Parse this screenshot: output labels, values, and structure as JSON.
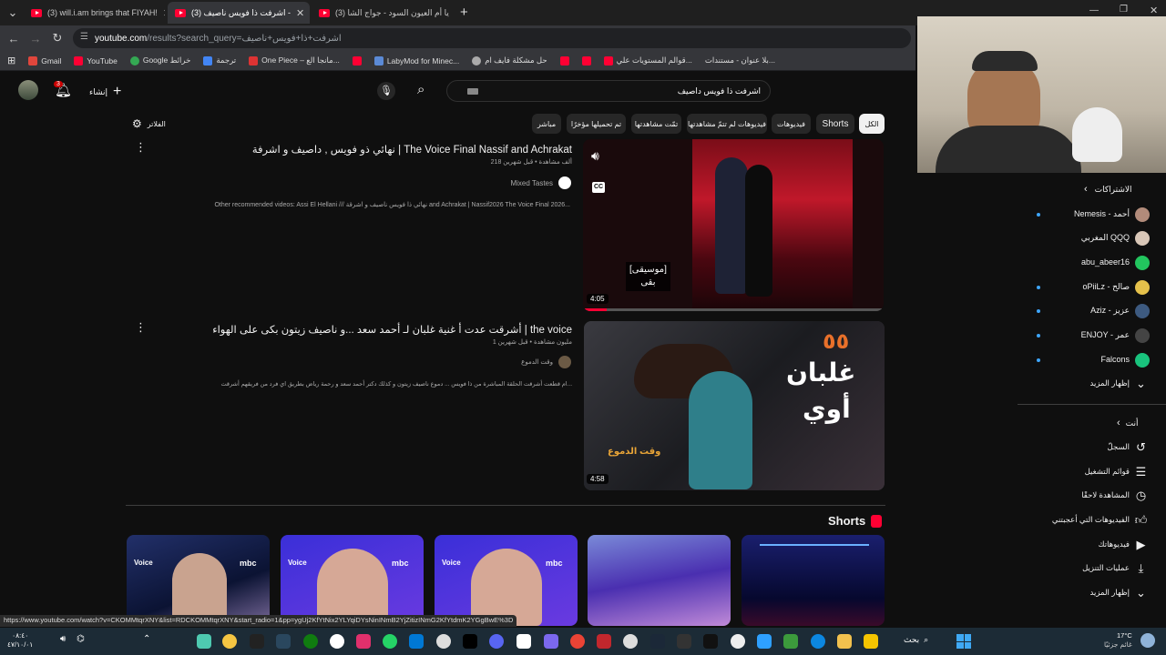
{
  "tabs": [
    {
      "title": "(3) will.i.am brings that FIYAH!",
      "active": false
    },
    {
      "title": "(3) اشرفت ذا فويس ناصيف -",
      "active": true
    },
    {
      "title": "(3) يا أم العيون السود - جواج الشا",
      "active": false
    }
  ],
  "address": {
    "domain": "youtube.com",
    "path": "/results?search_query=اشرفت+ذا+فويس+ناصيف"
  },
  "bookmarks": [
    "Gmail",
    "YouTube",
    "Google خرائط",
    "ترجمة",
    "One Piece – مانجا الع...",
    "LabyMod for Minec...",
    "حل مشكلة فايف ام",
    "قوالم المستويات علي...",
    "بلا عنوان - مستندات..."
  ],
  "header": {
    "create_label": "إنشاء",
    "notif_count": "3",
    "search_value": "اشرفت ذا فويس داصيف"
  },
  "chips": [
    "الكل",
    "Shorts",
    "فيديوهات",
    "فيديوهات لم تتمّ مشاهدتها",
    "تمّت مشاهدتها",
    "تم تحميلها مؤخرًا",
    "مباشر"
  ],
  "filters_label": "الفلاتر",
  "videos": [
    {
      "title": "نهائي ذو فويس , داصيف و اشرفة | The Voice Final Nassif and Achrakat",
      "meta": "218 ألف مشاهدة • قبل شهرين",
      "channel": "Mixed Tastes",
      "desc": "Other recommended videos: Assi El Hellani /// نهائي ذا فويس ناصيف و اشرقة and Achrakat | Nassif2026 The Voice Final 2026...",
      "duration": "4:05",
      "caption": "[موسيقى]\nبقى"
    },
    {
      "title": "أشرقت عدت أ غنية غلبان لـ أحمد سعد ...و ناصيف زيتون بكى على الهواء | the voice",
      "meta": "1 مليون مشاهدة • قبل شهرين",
      "channel": "وقت الدموع",
      "desc": "ام قطعت أشرقت الحلقة المباشرة من ذا فويس ... دموع ناصيف زيتون و كذلك دكتر أحمد سعد و رحمة رياض بطريق اي فرد من فريقهم أشرقت...",
      "duration": "4:58",
      "overlay_line1": "غلبان",
      "overlay_line2": "أوي"
    }
  ],
  "shorts_title": "Shorts",
  "subscriptions": {
    "heading": "الاشتراكات",
    "items": [
      {
        "name": "Nemesis - أحمد",
        "dot": true,
        "color": "#b28b7a"
      },
      {
        "name": "المغربي QQQ",
        "dot": false,
        "color": "#d9c7b8"
      },
      {
        "name": "abu_abeer16",
        "dot": false,
        "color": "#22c55e"
      },
      {
        "name": "oPiiLz - صالح",
        "dot": true,
        "color": "#e5c14b"
      },
      {
        "name": "Aziz - عزيز",
        "dot": true,
        "color": "#3d5a80"
      },
      {
        "name": "ENJOY - عمر",
        "dot": true,
        "color": "#444444"
      },
      {
        "name": "Falcons",
        "dot": true,
        "color": "#19c37d"
      }
    ],
    "show_more": "إظهار المزيد"
  },
  "you_section": {
    "heading": "أنت",
    "items": [
      {
        "name": "السجلّ",
        "icon": "history-icon"
      },
      {
        "name": "قوائم التشغيل",
        "icon": "playlist-icon"
      },
      {
        "name": "المشاهدة لاحقًا",
        "icon": "watch-later-icon"
      },
      {
        "name": "الفيديوهات التي أعجبتني",
        "icon": "like-icon"
      },
      {
        "name": "فيديوهاتك",
        "icon": "your-videos-icon"
      },
      {
        "name": "عمليات التنزيل",
        "icon": "download-icon"
      },
      {
        "name": "إظهار المزيد",
        "icon": "chevron-down-icon"
      }
    ]
  },
  "status_url": "https://www.youtube.com/watch?v=CKOMMtqrXNY&list=RDCKOMMtqrXNY&start_radio=1&pp=ygUj2KfYtNix2YLYqiDYsNinINmB2YjZitizINmG2KfYtdmK2YGgBwE%3D",
  "taskbar": {
    "weather_temp": "17°C",
    "weather_text": "غائم جزئيًا",
    "search_label": "بحث",
    "time": "٠٨:٤٠",
    "date": "٤٧/١٠/٠١"
  }
}
